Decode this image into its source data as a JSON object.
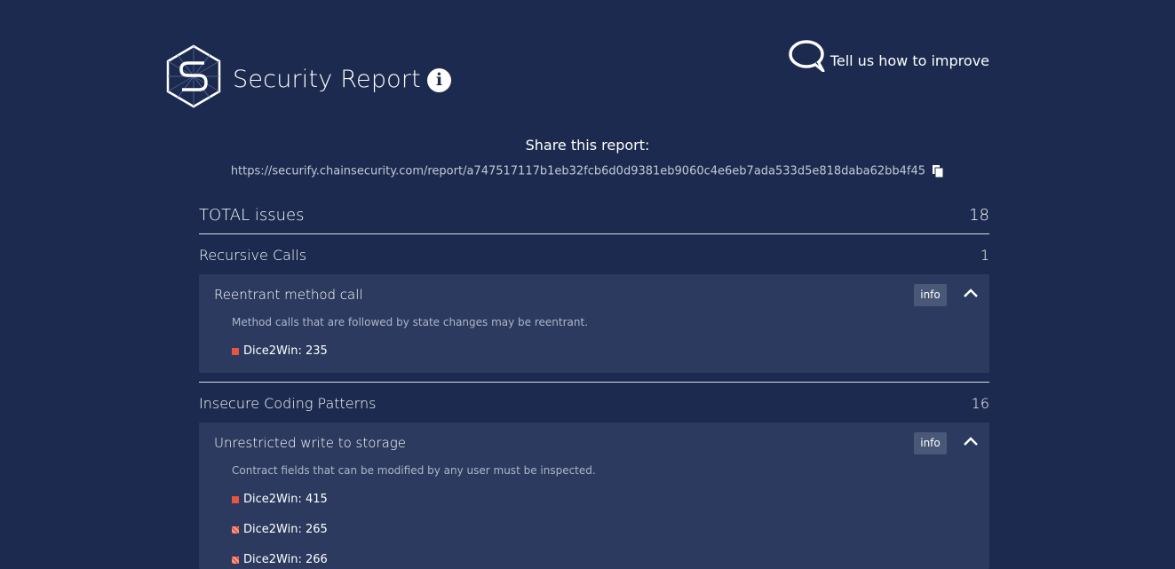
{
  "header": {
    "title": "Security Report",
    "info_glyph": "i",
    "feedback_label": "Tell us how to improve"
  },
  "share": {
    "title": "Share this report:",
    "url": "https://securify.chainsecurity.com/report/a747517117b1eb32fcb6d0d9381eb9060c4e6eb7ada533d5e818daba62bb4f45"
  },
  "summary": {
    "total_label": "TOTAL issues",
    "total_count": "18"
  },
  "categories": [
    {
      "name": "Recursive Calls",
      "count": "1",
      "issue": {
        "title": "Reentrant method call",
        "badge": "info",
        "description": "Method calls that are followed by state changes may be reentrant.",
        "findings": [
          "Dice2Win: 235"
        ]
      }
    },
    {
      "name": "Insecure Coding Patterns",
      "count": "16",
      "issue": {
        "title": "Unrestricted write to storage",
        "badge": "info",
        "description": "Contract fields that can be modified by any user must be inspected.",
        "findings": [
          "Dice2Win: 415",
          "Dice2Win: 265",
          "Dice2Win: 266"
        ]
      }
    }
  ],
  "colors": {
    "background": "#1b2a4e",
    "card": "#2b3a5e",
    "severity_high": "#e8553d"
  },
  "icons": [
    "securify-logo-icon",
    "info-circle-icon",
    "speech-bubble-icon",
    "copy-icon",
    "chevron-up-icon",
    "severity-square-icon"
  ]
}
